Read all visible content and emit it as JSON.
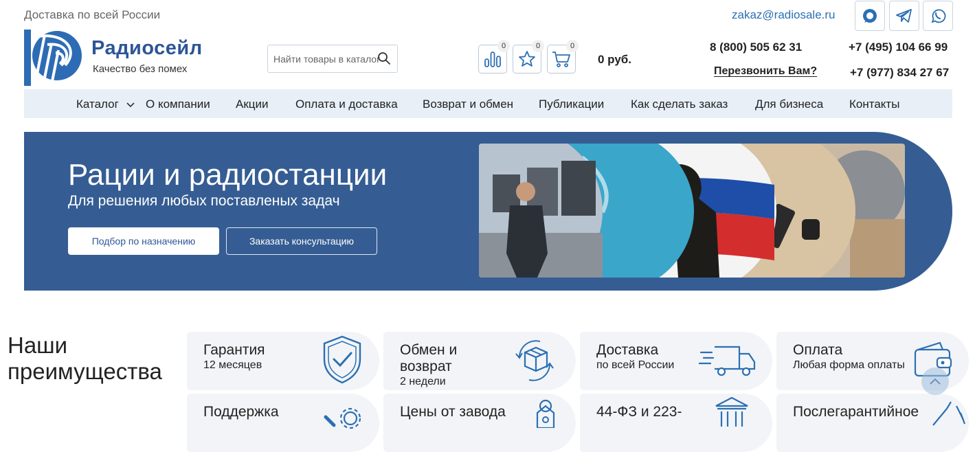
{
  "header": {
    "delivery": "Доставка по всей России",
    "email": "zakaz@radiosale.ru",
    "brand": "Радиосейл",
    "tagline": "Качество без помех",
    "search_placeholder": "Найти товары в каталоге",
    "compare_count": "0",
    "favorites_count": "0",
    "cart_count": "0",
    "cart_total": "0 руб.",
    "phone1": "8 (800) 505 62 31",
    "phone2": "+7 (495) 104 66 99",
    "phone3": "+7 (977) 834 27 67",
    "callback": "Перезвонить Вам?"
  },
  "nav": [
    "Каталог",
    "О компании",
    "Акции",
    "Оплата и доставка",
    "Возврат и обмен",
    "Публикации",
    "Как сделать заказ",
    "Для бизнеса",
    "Контакты"
  ],
  "hero": {
    "title": "Рации и радиостанции",
    "subtitle": "Для решения любых поставленых задач",
    "btn_primary": "Подбор по назначению",
    "btn_secondary": "Заказать консультацию"
  },
  "advantages": {
    "title_line1": "Наши",
    "title_line2": "преимущества",
    "cards": [
      {
        "title": "Гарантия",
        "subtitle": "12 месяцев",
        "icon": "shield-check-icon"
      },
      {
        "title": "Обмен и",
        "title2": "возврат",
        "subtitle": "2 недели",
        "icon": "box-exchange-icon"
      },
      {
        "title": "Доставка",
        "subtitle": "по всей России",
        "icon": "truck-icon"
      },
      {
        "title": "Оплата",
        "subtitle": "Любая форма оплаты",
        "icon": "wallet-icon"
      },
      {
        "title": "Поддержка",
        "icon": "tools-gear-icon"
      },
      {
        "title": "Цены от завода",
        "icon": "price-tag-icon"
      },
      {
        "title": "44-ФЗ и 223-",
        "icon": "government-building-icon"
      },
      {
        "title": "Послегарантийное",
        "icon": "wrench-icon"
      }
    ]
  },
  "colors": {
    "brand": "#2d5597",
    "hero_bg": "#355d93",
    "nav_bg": "#e8eff7",
    "card_bg": "#f2f4f7"
  }
}
